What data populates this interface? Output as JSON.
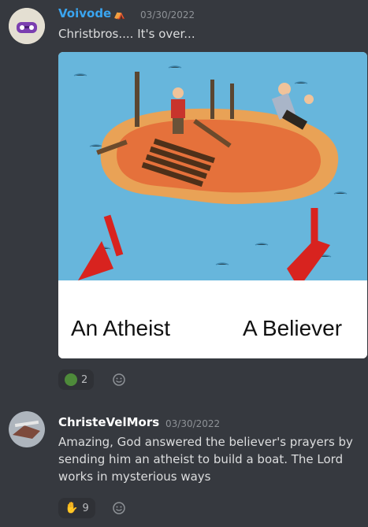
{
  "messages": [
    {
      "author": "Voivode",
      "author_color": "#3aa5f0",
      "timestamp": "03/30/2022",
      "text": "Christbros.... It's over...",
      "image": {
        "left_caption": "An Atheist",
        "right_caption": "A Believer"
      },
      "reactions": [
        {
          "icon": "pepe-emoji-icon",
          "count": "2"
        }
      ]
    },
    {
      "author": "ChristeVelMors",
      "author_color": "#ffffff",
      "timestamp": "03/30/2022",
      "text": "Amazing, God answered the believer's prayers by sending him an atheist to build a boat. The Lord works in mysterious ways",
      "reactions": [
        {
          "icon": "praying-hands-emoji-icon",
          "count": "9"
        }
      ]
    }
  ],
  "colors": {
    "background": "#36393f",
    "reaction_bg": "#2f3136",
    "timestamp": "#8e9297"
  }
}
